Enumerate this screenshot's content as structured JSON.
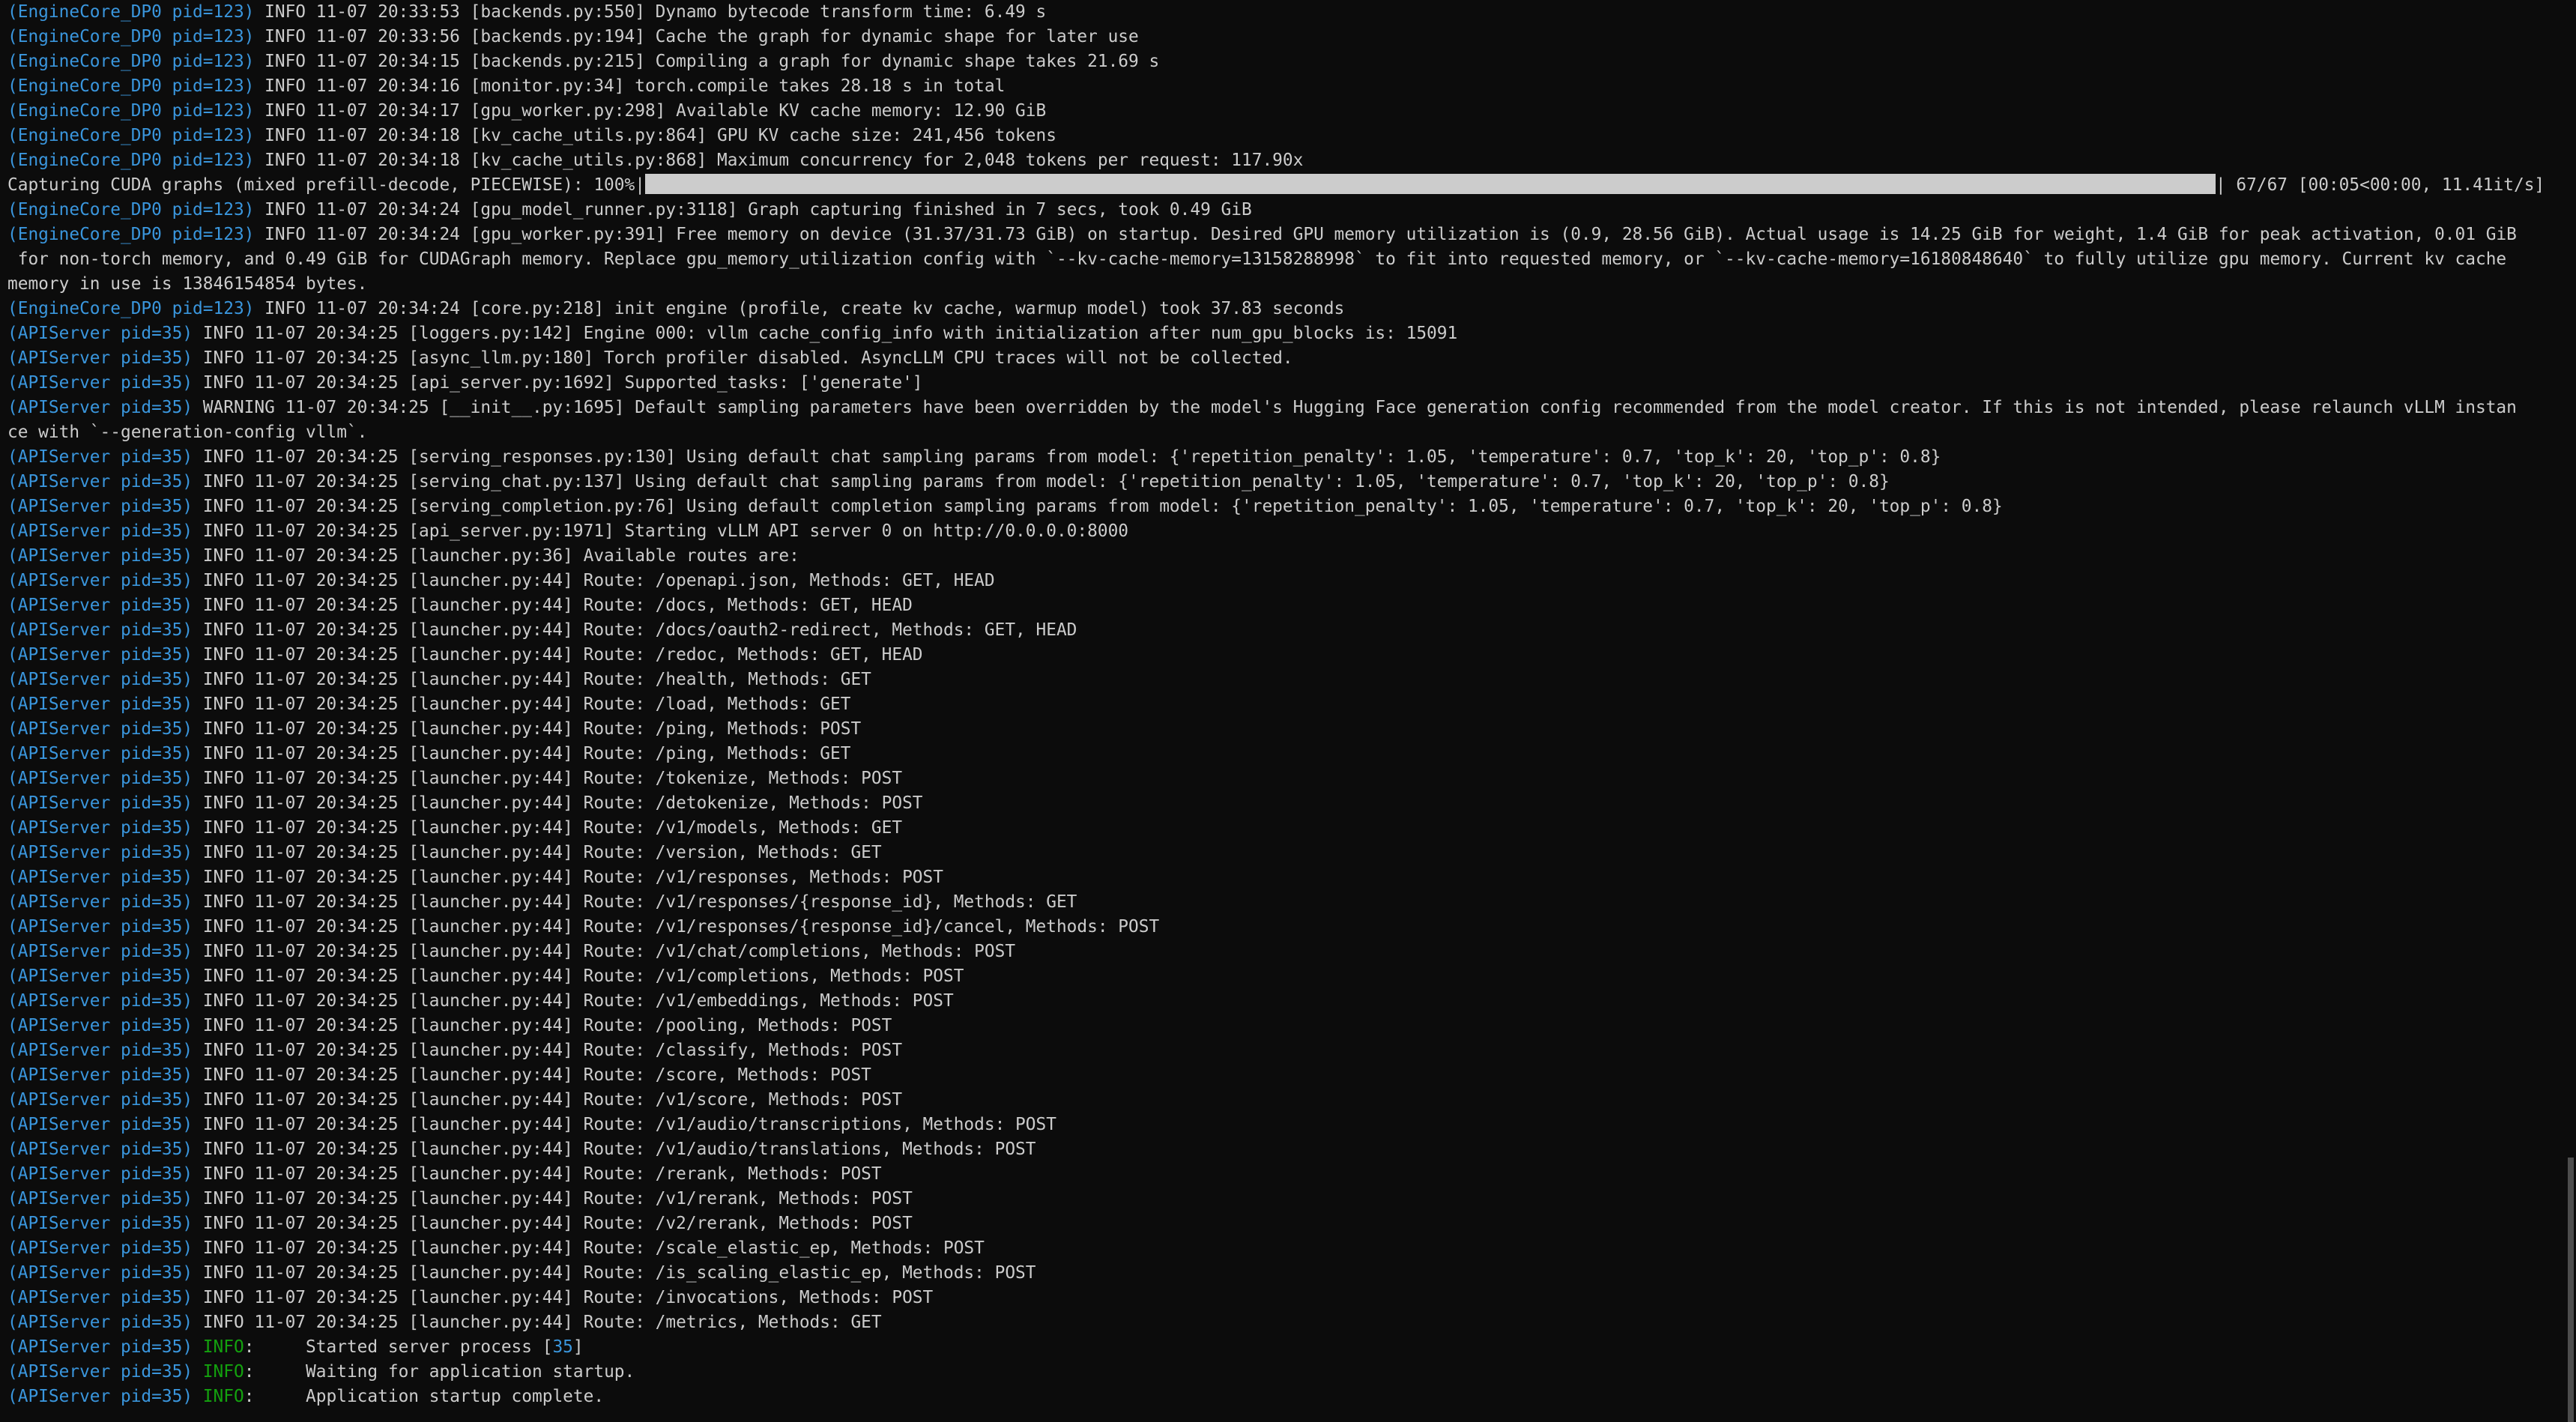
{
  "terminal": {
    "lines": [
      {
        "proc": "(EngineCore_DP0 pid=123)",
        "text": " INFO 11-07 20:33:53 [backends.py:550] Dynamo bytecode transform time: 6.49 s"
      },
      {
        "proc": "(EngineCore_DP0 pid=123)",
        "text": " INFO 11-07 20:33:56 [backends.py:194] Cache the graph for dynamic shape for later use"
      },
      {
        "proc": "(EngineCore_DP0 pid=123)",
        "text": " INFO 11-07 20:34:15 [backends.py:215] Compiling a graph for dynamic shape takes 21.69 s"
      },
      {
        "proc": "(EngineCore_DP0 pid=123)",
        "text": " INFO 11-07 20:34:16 [monitor.py:34] torch.compile takes 28.18 s in total"
      },
      {
        "proc": "(EngineCore_DP0 pid=123)",
        "text": " INFO 11-07 20:34:17 [gpu_worker.py:298] Available KV cache memory: 12.90 GiB"
      },
      {
        "proc": "(EngineCore_DP0 pid=123)",
        "text": " INFO 11-07 20:34:18 [kv_cache_utils.py:864] GPU KV cache size: 241,456 tokens"
      },
      {
        "proc": "(EngineCore_DP0 pid=123)",
        "text": " INFO 11-07 20:34:18 [kv_cache_utils.py:868] Maximum concurrency for 2,048 tokens per request: 117.90x"
      }
    ],
    "progress": {
      "prefix": "Capturing CUDA graphs (mixed prefill-decode, PIECEWISE): 100%|",
      "suffix": "| 67/67 [00:05<00:00, 11.41it/s]",
      "fraction": 1.0
    },
    "lines2": [
      {
        "proc": "(EngineCore_DP0 pid=123)",
        "text": " INFO 11-07 20:34:24 [gpu_model_runner.py:3118] Graph capturing finished in 7 secs, took 0.49 GiB"
      },
      {
        "proc": "(EngineCore_DP0 pid=123)",
        "text": " INFO 11-07 20:34:24 [gpu_worker.py:391] Free memory on device (31.37/31.73 GiB) on startup. Desired GPU memory utilization is (0.9, 28.56 GiB). Actual usage is 14.25 GiB for weight, 1.4 GiB for peak activation, 0.01 GiB"
      },
      {
        "proc": "",
        "text": " for non-torch memory, and 0.49 GiB for CUDAGraph memory. Replace gpu_memory_utilization config with `--kv-cache-memory=13158288998` to fit into requested memory, or `--kv-cache-memory=16180848640` to fully utilize gpu memory. Current kv cache"
      },
      {
        "proc": "",
        "text": "memory in use is 13846154854 bytes."
      },
      {
        "proc": "(EngineCore_DP0 pid=123)",
        "text": " INFO 11-07 20:34:24 [core.py:218] init engine (profile, create kv cache, warmup model) took 37.83 seconds"
      },
      {
        "proc": "(APIServer pid=35)",
        "text": " INFO 11-07 20:34:25 [loggers.py:142] Engine 000: vllm cache_config_info with initialization after num_gpu_blocks is: 15091"
      },
      {
        "proc": "(APIServer pid=35)",
        "text": " INFO 11-07 20:34:25 [async_llm.py:180] Torch profiler disabled. AsyncLLM CPU traces will not be collected."
      },
      {
        "proc": "(APIServer pid=35)",
        "text": " INFO 11-07 20:34:25 [api_server.py:1692] Supported_tasks: ['generate']"
      },
      {
        "proc": "(APIServer pid=35)",
        "text": " WARNING 11-07 20:34:25 [__init__.py:1695] Default sampling parameters have been overridden by the model's Hugging Face generation config recommended from the model creator. If this is not intended, please relaunch vLLM instan"
      },
      {
        "proc": "",
        "text": "ce with `--generation-config vllm`."
      },
      {
        "proc": "(APIServer pid=35)",
        "text": " INFO 11-07 20:34:25 [serving_responses.py:130] Using default chat sampling params from model: {'repetition_penalty': 1.05, 'temperature': 0.7, 'top_k': 20, 'top_p': 0.8}"
      },
      {
        "proc": "(APIServer pid=35)",
        "text": " INFO 11-07 20:34:25 [serving_chat.py:137] Using default chat sampling params from model: {'repetition_penalty': 1.05, 'temperature': 0.7, 'top_k': 20, 'top_p': 0.8}"
      },
      {
        "proc": "(APIServer pid=35)",
        "text": " INFO 11-07 20:34:25 [serving_completion.py:76] Using default completion sampling params from model: {'repetition_penalty': 1.05, 'temperature': 0.7, 'top_k': 20, 'top_p': 0.8}"
      },
      {
        "proc": "(APIServer pid=35)",
        "text": " INFO 11-07 20:34:25 [api_server.py:1971] Starting vLLM API server 0 on http://0.0.0.0:8000"
      },
      {
        "proc": "(APIServer pid=35)",
        "text": " INFO 11-07 20:34:25 [launcher.py:36] Available routes are:"
      },
      {
        "proc": "(APIServer pid=35)",
        "text": " INFO 11-07 20:34:25 [launcher.py:44] Route: /openapi.json, Methods: GET, HEAD"
      },
      {
        "proc": "(APIServer pid=35)",
        "text": " INFO 11-07 20:34:25 [launcher.py:44] Route: /docs, Methods: GET, HEAD"
      },
      {
        "proc": "(APIServer pid=35)",
        "text": " INFO 11-07 20:34:25 [launcher.py:44] Route: /docs/oauth2-redirect, Methods: GET, HEAD"
      },
      {
        "proc": "(APIServer pid=35)",
        "text": " INFO 11-07 20:34:25 [launcher.py:44] Route: /redoc, Methods: GET, HEAD"
      },
      {
        "proc": "(APIServer pid=35)",
        "text": " INFO 11-07 20:34:25 [launcher.py:44] Route: /health, Methods: GET"
      },
      {
        "proc": "(APIServer pid=35)",
        "text": " INFO 11-07 20:34:25 [launcher.py:44] Route: /load, Methods: GET"
      },
      {
        "proc": "(APIServer pid=35)",
        "text": " INFO 11-07 20:34:25 [launcher.py:44] Route: /ping, Methods: POST"
      },
      {
        "proc": "(APIServer pid=35)",
        "text": " INFO 11-07 20:34:25 [launcher.py:44] Route: /ping, Methods: GET"
      },
      {
        "proc": "(APIServer pid=35)",
        "text": " INFO 11-07 20:34:25 [launcher.py:44] Route: /tokenize, Methods: POST"
      },
      {
        "proc": "(APIServer pid=35)",
        "text": " INFO 11-07 20:34:25 [launcher.py:44] Route: /detokenize, Methods: POST"
      },
      {
        "proc": "(APIServer pid=35)",
        "text": " INFO 11-07 20:34:25 [launcher.py:44] Route: /v1/models, Methods: GET"
      },
      {
        "proc": "(APIServer pid=35)",
        "text": " INFO 11-07 20:34:25 [launcher.py:44] Route: /version, Methods: GET"
      },
      {
        "proc": "(APIServer pid=35)",
        "text": " INFO 11-07 20:34:25 [launcher.py:44] Route: /v1/responses, Methods: POST"
      },
      {
        "proc": "(APIServer pid=35)",
        "text": " INFO 11-07 20:34:25 [launcher.py:44] Route: /v1/responses/{response_id}, Methods: GET"
      },
      {
        "proc": "(APIServer pid=35)",
        "text": " INFO 11-07 20:34:25 [launcher.py:44] Route: /v1/responses/{response_id}/cancel, Methods: POST"
      },
      {
        "proc": "(APIServer pid=35)",
        "text": " INFO 11-07 20:34:25 [launcher.py:44] Route: /v1/chat/completions, Methods: POST"
      },
      {
        "proc": "(APIServer pid=35)",
        "text": " INFO 11-07 20:34:25 [launcher.py:44] Route: /v1/completions, Methods: POST"
      },
      {
        "proc": "(APIServer pid=35)",
        "text": " INFO 11-07 20:34:25 [launcher.py:44] Route: /v1/embeddings, Methods: POST"
      },
      {
        "proc": "(APIServer pid=35)",
        "text": " INFO 11-07 20:34:25 [launcher.py:44] Route: /pooling, Methods: POST"
      },
      {
        "proc": "(APIServer pid=35)",
        "text": " INFO 11-07 20:34:25 [launcher.py:44] Route: /classify, Methods: POST"
      },
      {
        "proc": "(APIServer pid=35)",
        "text": " INFO 11-07 20:34:25 [launcher.py:44] Route: /score, Methods: POST"
      },
      {
        "proc": "(APIServer pid=35)",
        "text": " INFO 11-07 20:34:25 [launcher.py:44] Route: /v1/score, Methods: POST"
      },
      {
        "proc": "(APIServer pid=35)",
        "text": " INFO 11-07 20:34:25 [launcher.py:44] Route: /v1/audio/transcriptions, Methods: POST"
      },
      {
        "proc": "(APIServer pid=35)",
        "text": " INFO 11-07 20:34:25 [launcher.py:44] Route: /v1/audio/translations, Methods: POST"
      },
      {
        "proc": "(APIServer pid=35)",
        "text": " INFO 11-07 20:34:25 [launcher.py:44] Route: /rerank, Methods: POST"
      },
      {
        "proc": "(APIServer pid=35)",
        "text": " INFO 11-07 20:34:25 [launcher.py:44] Route: /v1/rerank, Methods: POST"
      },
      {
        "proc": "(APIServer pid=35)",
        "text": " INFO 11-07 20:34:25 [launcher.py:44] Route: /v2/rerank, Methods: POST"
      },
      {
        "proc": "(APIServer pid=35)",
        "text": " INFO 11-07 20:34:25 [launcher.py:44] Route: /scale_elastic_ep, Methods: POST"
      },
      {
        "proc": "(APIServer pid=35)",
        "text": " INFO 11-07 20:34:25 [launcher.py:44] Route: /is_scaling_elastic_ep, Methods: POST"
      },
      {
        "proc": "(APIServer pid=35)",
        "text": " INFO 11-07 20:34:25 [launcher.py:44] Route: /invocations, Methods: POST"
      },
      {
        "proc": "(APIServer pid=35)",
        "text": " INFO 11-07 20:34:25 [launcher.py:44] Route: /metrics, Methods: GET"
      }
    ],
    "uvicorn_lines": [
      {
        "proc": "(APIServer pid=35)",
        "level": "INFO",
        "text_a": ":     Started server process [",
        "pid": "35",
        "text_b": "]"
      },
      {
        "proc": "(APIServer pid=35)",
        "level": "INFO",
        "text_a": ":     Waiting for application startup.",
        "pid": "",
        "text_b": ""
      },
      {
        "proc": "(APIServer pid=35)",
        "level": "INFO",
        "text_a": ":     Application startup complete.",
        "pid": "",
        "text_b": ""
      }
    ],
    "colors": {
      "background": "#0c0c0c",
      "foreground": "#cccccc",
      "process_prefix": "#3a96dd",
      "level_green": "#13a10e",
      "scroll_thumb": "#4d4d4d"
    },
    "scroll_position": 0.81
  }
}
